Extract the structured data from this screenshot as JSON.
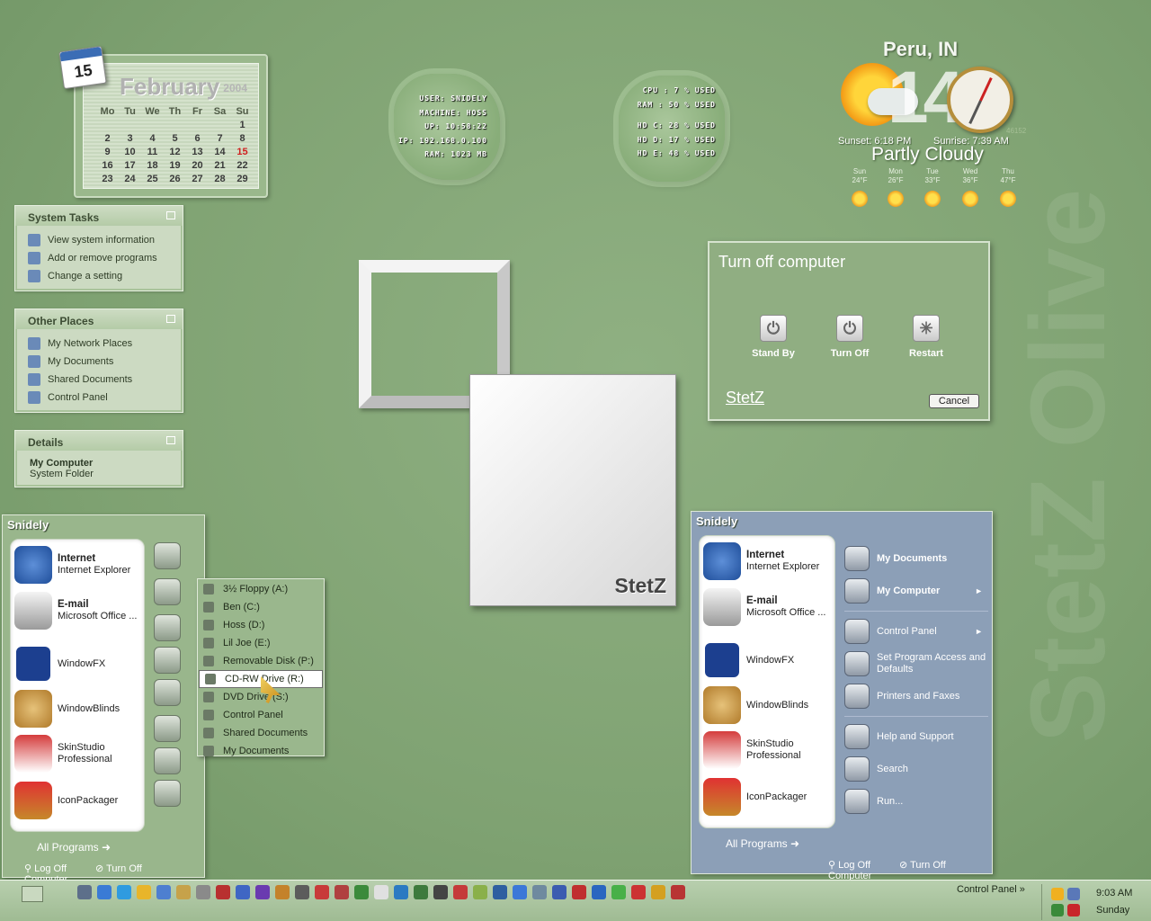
{
  "watermark": "StetZ Olive",
  "calendar": {
    "day_badge": "15",
    "month": "February",
    "year": "2004",
    "weekdays": [
      "Mo",
      "Tu",
      "We",
      "Th",
      "Fr",
      "Sa",
      "Su"
    ],
    "weeks": [
      [
        "",
        "",
        "",
        "",
        "",
        "",
        "1"
      ],
      [
        "2",
        "3",
        "4",
        "5",
        "6",
        "7",
        "8"
      ],
      [
        "9",
        "10",
        "11",
        "12",
        "13",
        "14",
        "15"
      ],
      [
        "16",
        "17",
        "18",
        "19",
        "20",
        "21",
        "22"
      ],
      [
        "23",
        "24",
        "25",
        "26",
        "27",
        "28",
        "29"
      ]
    ],
    "today": "15"
  },
  "sysinfo": {
    "lines": [
      "USER: SNIDELY",
      "MACHINE: HOSS",
      "UP: 10:58:22",
      "IP: 192.168.0.100",
      "RAM: 1023 MB"
    ]
  },
  "usage": {
    "lines": [
      "CPU : 7 % USED",
      "RAM : 50 % USED",
      "HD C: 28 % USED",
      "HD D: 17 % USED",
      "HD E: 48 % USED"
    ]
  },
  "weather": {
    "location": "Peru, IN",
    "temperature": "14",
    "sunset": "Sunset: 6:18 PM",
    "sunrise": "Sunrise: 7:39 AM",
    "condition": "Partly Cloudy",
    "code": "46152",
    "forecast": [
      {
        "day": "Sun",
        "temp": "24°F"
      },
      {
        "day": "Mon",
        "temp": "26°F"
      },
      {
        "day": "Tue",
        "temp": "33°F"
      },
      {
        "day": "Wed",
        "temp": "36°F"
      },
      {
        "day": "Thu",
        "temp": "47°F"
      }
    ]
  },
  "task_panes": {
    "system_tasks": {
      "title": "System Tasks",
      "items": [
        "View system information",
        "Add or remove programs",
        "Change a setting"
      ]
    },
    "other_places": {
      "title": "Other Places",
      "items": [
        "My Network Places",
        "My Documents",
        "Shared Documents",
        "Control Panel"
      ]
    },
    "details": {
      "title": "Details",
      "name": "My Computer",
      "type": "System Folder"
    }
  },
  "logo_tile": "StetZ",
  "turn_off_dialog": {
    "title": "Turn off computer",
    "stand_by": "Stand By",
    "turn_off": "Turn Off",
    "restart": "Restart",
    "brand": "StetZ",
    "cancel": "Cancel"
  },
  "start_menu_left": {
    "user": "Snidely",
    "pinned": [
      {
        "title": "Internet",
        "sub": "Internet Explorer"
      },
      {
        "title": "E-mail",
        "sub": "Microsoft Office ..."
      }
    ],
    "recent": [
      "WindowFX",
      "WindowBlinds",
      "SkinStudio Professional",
      "IconPackager"
    ],
    "all_programs": "All Programs",
    "log_off": "Log Off",
    "turn_off": "Turn Off Computer"
  },
  "submenu": {
    "items": [
      "3½ Floppy (A:)",
      "Ben (C:)",
      "Hoss (D:)",
      "Lil Joe (E:)",
      "Removable Disk (P:)",
      "CD-RW Drive (R:)",
      "DVD Drive (S:)",
      "Control Panel",
      "Shared Documents",
      "My Documents"
    ],
    "selected": "CD-RW Drive (R:)"
  },
  "start_menu_right": {
    "user": "Snidely",
    "pinned": [
      {
        "title": "Internet",
        "sub": "Internet Explorer"
      },
      {
        "title": "E-mail",
        "sub": "Microsoft Office ..."
      }
    ],
    "recent": [
      "WindowFX",
      "WindowBlinds",
      "SkinStudio Professional",
      "IconPackager"
    ],
    "places": [
      "My Documents",
      "My Computer"
    ],
    "settings": [
      "Control Panel",
      "Set Program Access and Defaults",
      "Printers and Faxes"
    ],
    "tools": [
      "Help and Support",
      "Search",
      "Run..."
    ],
    "all_programs": "All Programs",
    "log_off": "Log Off",
    "turn_off": "Turn Off Computer"
  },
  "taskbar": {
    "toolbar_label": "Control Panel",
    "time": "9:03 AM",
    "day": "Sunday"
  }
}
